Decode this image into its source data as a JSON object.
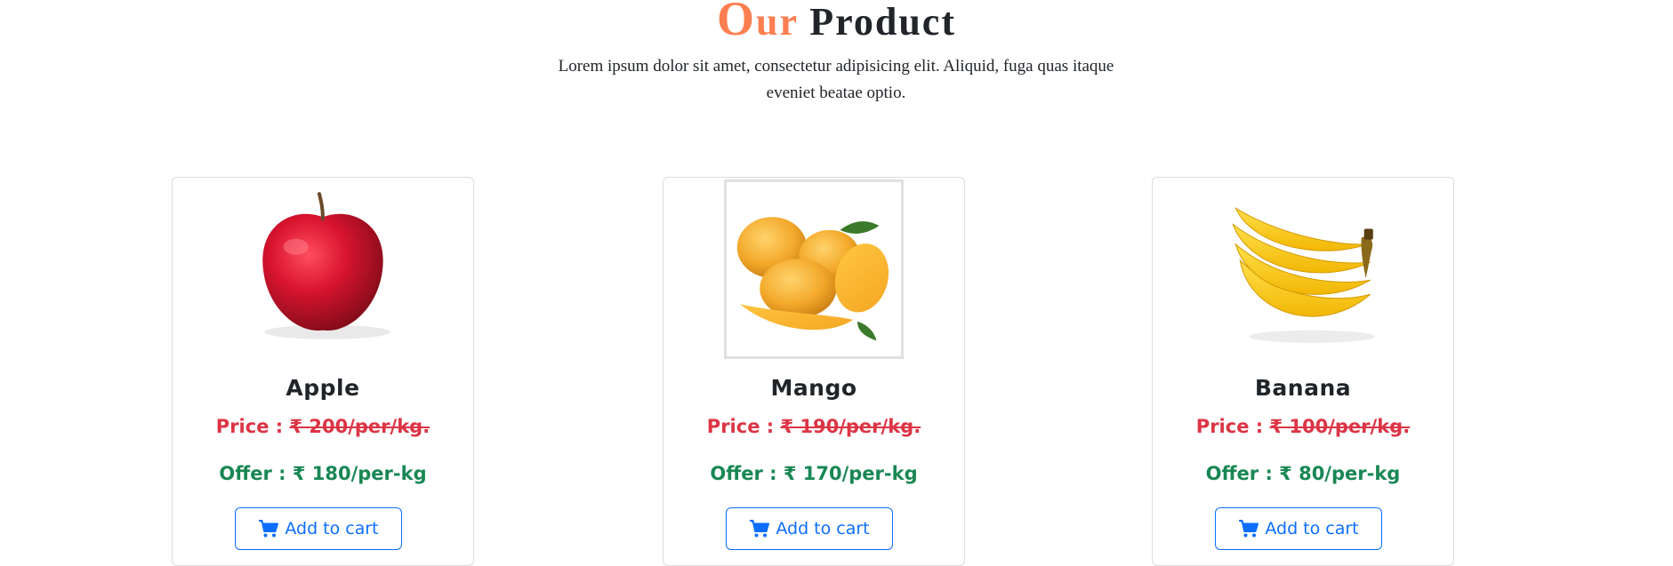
{
  "section": {
    "title_accent_first": "O",
    "title_accent_rest": "ur",
    "title_main": "Product",
    "description": "Lorem ipsum dolor sit amet, consectetur adipisicing elit. Aliquid, fuga quas itaque eveniet beatae optio."
  },
  "colors": {
    "accent": "#fd7e50",
    "price": "#dc3545",
    "offer": "#198754",
    "button": "#0d6efd"
  },
  "products": [
    {
      "name": "Apple",
      "price_label": "Price : ",
      "price_value": "₹ 200/per/kg.",
      "offer": "Offer : ₹ 180/per-kg",
      "button_label": "Add to cart",
      "image_icon": "apple-image"
    },
    {
      "name": "Mango",
      "price_label": "Price : ",
      "price_value": "₹ 190/per/kg.",
      "offer": "Offer : ₹ 170/per-kg",
      "button_label": "Add to cart",
      "image_icon": "mango-image"
    },
    {
      "name": "Banana",
      "price_label": "Price : ",
      "price_value": "₹ 100/per/kg.",
      "offer": "Offer : ₹ 80/per-kg",
      "button_label": "Add to cart",
      "image_icon": "banana-image"
    }
  ]
}
